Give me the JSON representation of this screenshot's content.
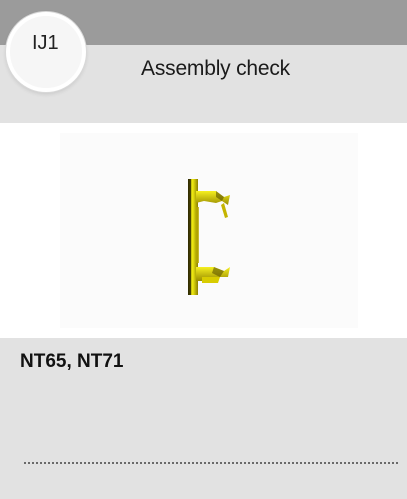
{
  "header": {
    "code": "IJ1",
    "title": "Assembly check"
  },
  "image": {
    "icon": "yellow-bracket-part-icon",
    "colors": {
      "bright": "#f4ee12",
      "mid": "#c4b400",
      "dark": "#2a2600"
    }
  },
  "details": {
    "models": "NT65, NT71"
  },
  "colors": {
    "top_bar": "#9b9b9b",
    "band": "#e2e2e2"
  }
}
